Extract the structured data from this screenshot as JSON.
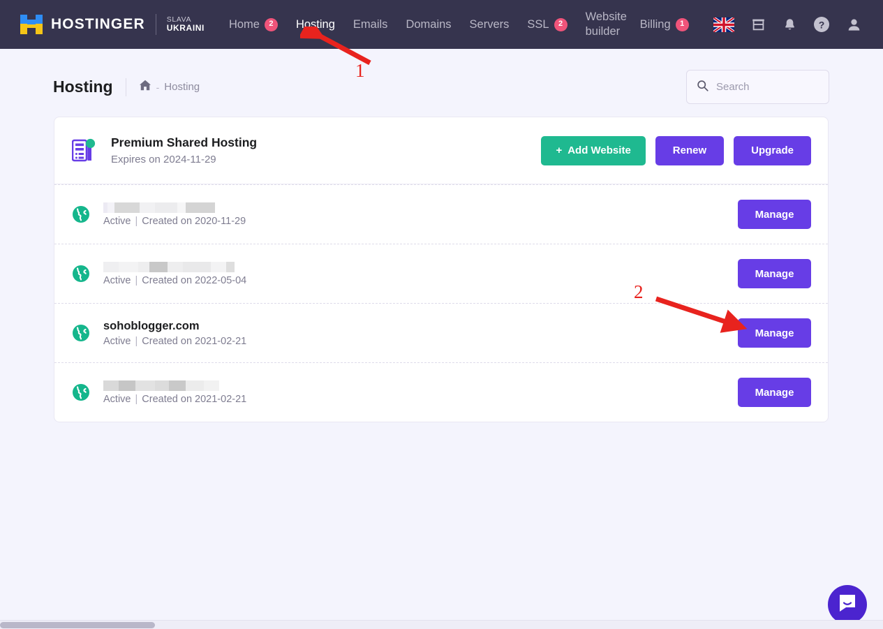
{
  "brand": {
    "name": "HOSTINGER",
    "logo_icon": "hostinger-logo-icon",
    "slava_line1": "SLAVA",
    "slava_line2": "UKRAINI"
  },
  "nav": {
    "items": [
      {
        "label": "Home",
        "badge": "2",
        "active": false
      },
      {
        "label": "Hosting",
        "badge": "",
        "active": true
      },
      {
        "label": "Emails",
        "badge": "",
        "active": false
      },
      {
        "label": "Domains",
        "badge": "",
        "active": false
      },
      {
        "label": "Servers",
        "badge": "",
        "active": false
      },
      {
        "label": "SSL",
        "badge": "2",
        "active": false
      },
      {
        "label": "Website builder",
        "badge": "",
        "active": false
      },
      {
        "label": "Billing",
        "badge": "1",
        "active": false
      }
    ],
    "icons": [
      "flag-uk-icon",
      "store-icon",
      "bell-icon",
      "help-circle-icon",
      "user-icon"
    ]
  },
  "header": {
    "title": "Hosting",
    "breadcrumb_home_icon": "home-icon",
    "breadcrumb_separator": "-",
    "breadcrumb_current": "Hosting"
  },
  "search": {
    "placeholder": "Search",
    "value": "",
    "icon": "search-icon"
  },
  "plan": {
    "icon": "server-icon",
    "status_dot_color": "#1fb990",
    "name": "Premium Shared Hosting",
    "expiry": "Expires on 2024-11-29",
    "add_website_label": "Add Website",
    "add_website_plus": "+",
    "renew_label": "Renew",
    "upgrade_label": "Upgrade"
  },
  "sites": [
    {
      "icon": "globe-icon",
      "name": "",
      "redacted": true,
      "status": "Active",
      "separator": "|",
      "created": "Created on 2020-11-29",
      "manage_label": "Manage"
    },
    {
      "icon": "globe-icon",
      "name": "",
      "redacted": true,
      "status": "Active",
      "separator": "|",
      "created": "Created on 2022-05-04",
      "manage_label": "Manage"
    },
    {
      "icon": "globe-icon",
      "name": "sohoblogger.com",
      "redacted": false,
      "status": "Active",
      "separator": "|",
      "created": "Created on 2021-02-21",
      "manage_label": "Manage"
    },
    {
      "icon": "globe-icon",
      "name": "",
      "redacted": true,
      "status": "Active",
      "separator": "|",
      "created": "Created on 2021-02-21",
      "manage_label": "Manage"
    }
  ],
  "annotations": [
    {
      "number": "1",
      "target": "hosting-nav-item"
    },
    {
      "number": "2",
      "target": "manage-button-row-3"
    }
  ],
  "chat": {
    "icon": "chat-bubble-icon"
  },
  "colors": {
    "nav_background": "#36344e",
    "accent_purple": "#673de6",
    "accent_green": "#1fb990",
    "badge_pink": "#f0547a",
    "annotation_red": "#e8231e",
    "page_background": "#f4f4fd"
  }
}
